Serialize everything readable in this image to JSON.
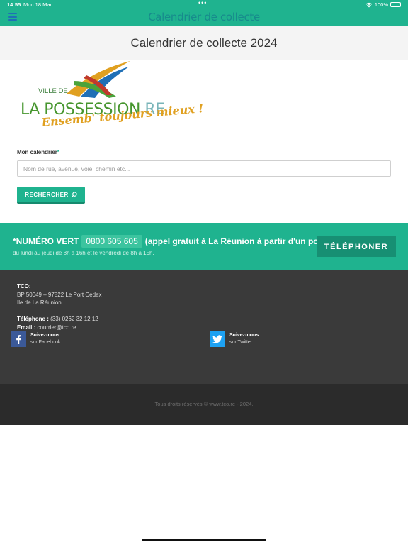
{
  "status": {
    "time": "14:55",
    "date": "Mon 18 Mar",
    "dots": "•••",
    "battery": "100%"
  },
  "nav": {
    "title": "Calendrier de collecte",
    "menu_icon": "hamburger-icon"
  },
  "page": {
    "title": "Calendrier de collecte 2024"
  },
  "logo": {
    "ville": "VILLE DE",
    "name_main": "LA POSSESSION",
    "name_ext": ".RE",
    "slogan": "Ensemb' toujours mieux !"
  },
  "form": {
    "label": "Mon calendrier",
    "required_mark": "*",
    "placeholder": "Nom de rue, avenue, voie, chemin etc...",
    "value": "",
    "button_label": "RECHERCHER"
  },
  "numero_vert": {
    "prefix": "*NUMÉRO VERT",
    "number": "0800 605 605",
    "note": "(appel gratuit à La Réunion à partir d'un poste fixe)",
    "hours": "du lundi au jeudi de 8h à 16h et le vendredi de 8h à 15h.",
    "button_label": "TÉLÉPHONER"
  },
  "footer": {
    "org": "TCO:",
    "address1": "BP 50049 – 97822 Le Port Cedex",
    "address2": "Ile de La Réunion",
    "phone_label": "Téléphone :",
    "phone": "(33) 0262 32 12 12",
    "email_label": "Email :",
    "email": "courrier@tco.re",
    "facebook_line1": "Suivez-nous",
    "facebook_line2": "sur Facebook",
    "twitter_line1": "Suivez-nous",
    "twitter_line2": "sur Twitter",
    "copyright": "Tous droits réservés © www.tco.re - 2024."
  },
  "colors": {
    "primary": "#1fb38f",
    "facebook": "#3b5998",
    "twitter": "#1da1f2",
    "footer": "#3a3a3a"
  }
}
